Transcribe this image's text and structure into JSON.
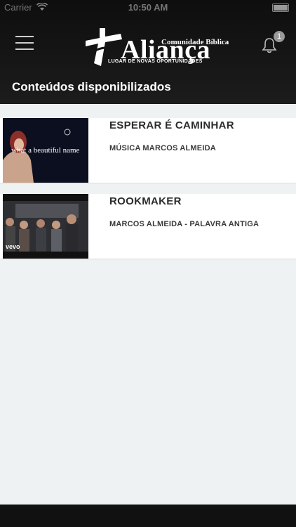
{
  "status": {
    "carrier": "Carrier",
    "time": "10:50 AM"
  },
  "header": {
    "logo_small": "Comunidade Bíblica",
    "logo_main": "Aliança",
    "logo_tagline": "LUGAR DE NOVAS OPORTUNIDADES",
    "notification_count": "1"
  },
  "page": {
    "title": "Conteúdos disponibilizados"
  },
  "items": [
    {
      "title": "ESPERAR É CAMINHAR",
      "subtitle": "MÚSICA MARCOS ALMEIDA",
      "thumb_text": "what a beautiful name"
    },
    {
      "title": "ROOKMAKER",
      "subtitle": "MARCOS ALMEIDA - PALAVRA ANTIGA",
      "thumb_text": "vevo"
    }
  ],
  "colors": {
    "header_bg": "#151515",
    "page_bg": "#eef2f2",
    "card_bg": "#ffffff",
    "badge": "#9a9a9a"
  }
}
